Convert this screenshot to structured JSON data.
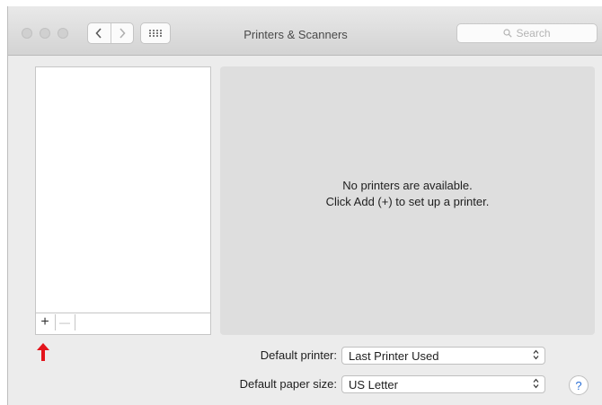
{
  "window": {
    "title": "Printers & Scanners",
    "search_placeholder": "Search"
  },
  "printer_list": {
    "add_label": "+",
    "remove_label": "—"
  },
  "detail": {
    "empty_line1": "No printers are available.",
    "empty_line2": "Click Add (+) to set up a printer."
  },
  "settings": {
    "default_printer_label": "Default printer:",
    "default_printer_value": "Last Printer Used",
    "paper_size_label": "Default paper size:",
    "paper_size_value": "US Letter"
  },
  "help_label": "?",
  "colors": {
    "annotation_arrow": "#e3141b",
    "help_accent": "#2a6fd6"
  }
}
